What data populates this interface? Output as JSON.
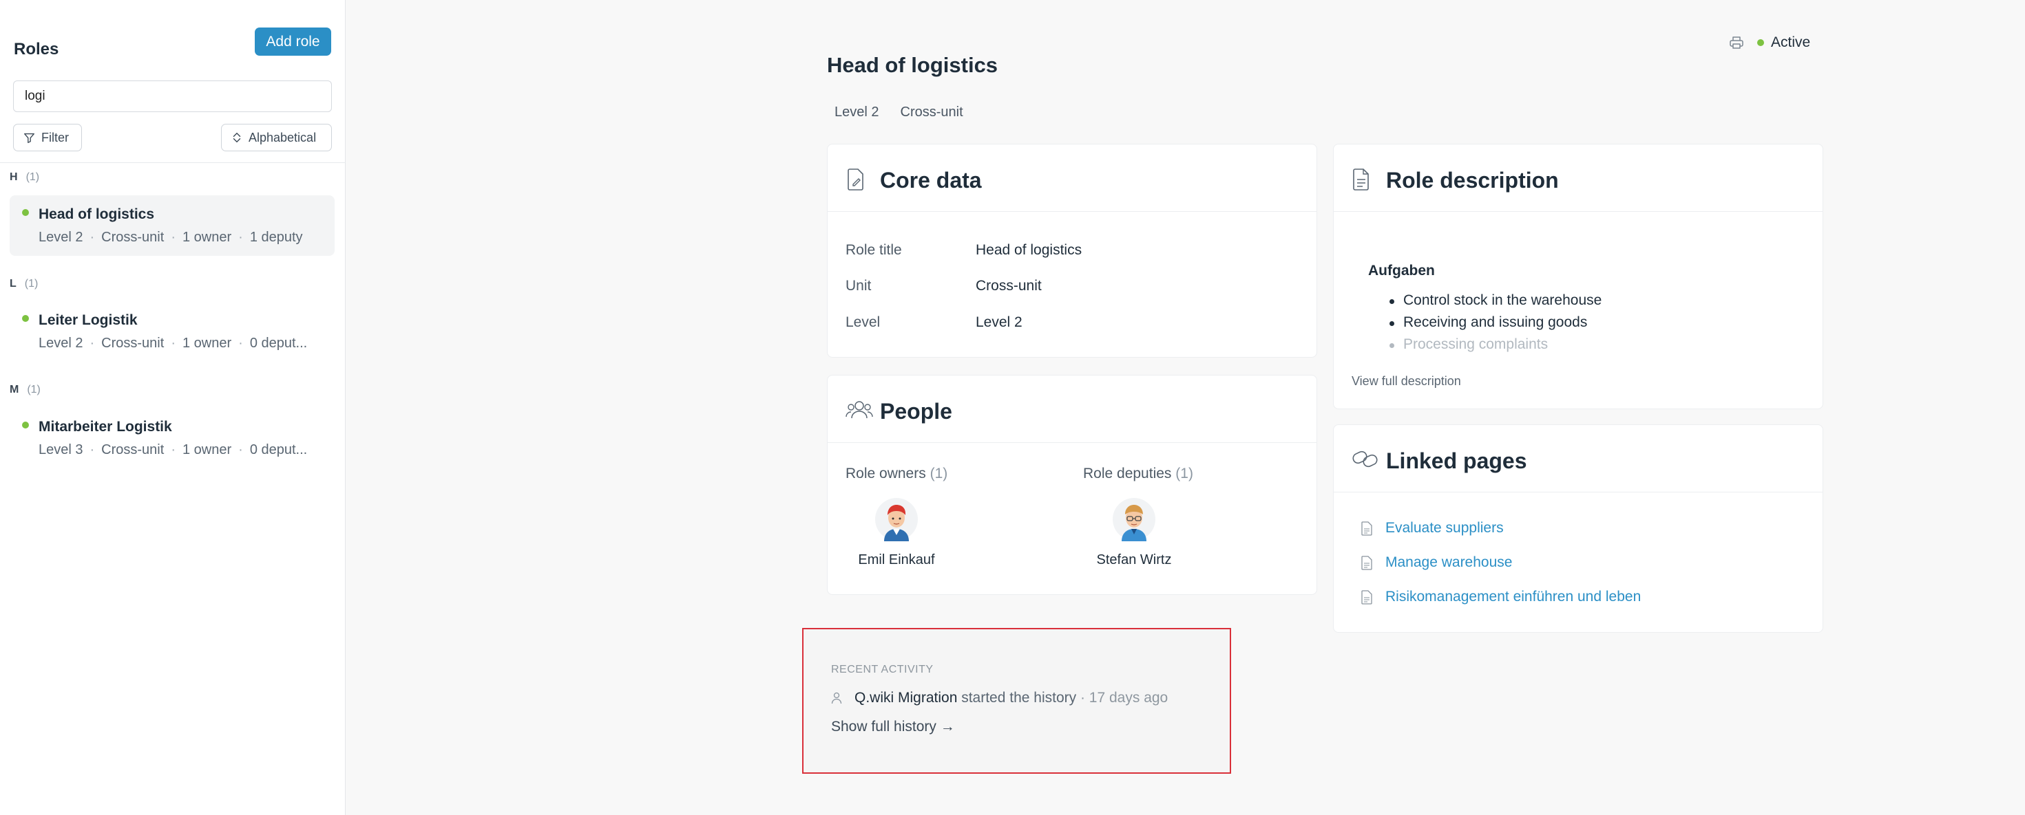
{
  "sidebar": {
    "title": "Roles",
    "add_label": "Add role",
    "search_value": "logi",
    "filter_label": "Filter",
    "sort_label": "Alphabetical",
    "groups": [
      {
        "letter": "H",
        "count": "(1)",
        "items": [
          {
            "name": "Head of logistics",
            "level": "Level 2",
            "unit": "Cross-unit",
            "owners": "1 owner",
            "deputies": "1 deputy"
          }
        ]
      },
      {
        "letter": "L",
        "count": "(1)",
        "items": [
          {
            "name": "Leiter Logistik",
            "level": "Level 2",
            "unit": "Cross-unit",
            "owners": "1 owner",
            "deputies": "0 deput..."
          }
        ]
      },
      {
        "letter": "M",
        "count": "(1)",
        "items": [
          {
            "name": "Mitarbeiter Logistik",
            "level": "Level 3",
            "unit": "Cross-unit",
            "owners": "1 owner",
            "deputies": "0 deput..."
          }
        ]
      }
    ]
  },
  "header": {
    "title": "Head of logistics",
    "tags": [
      "Level 2",
      "Cross-unit"
    ],
    "status": "Active"
  },
  "core_data": {
    "title": "Core data",
    "rows": [
      {
        "label": "Role title",
        "value": "Head of logistics"
      },
      {
        "label": "Unit",
        "value": "Cross-unit"
      },
      {
        "label": "Level",
        "value": "Level 2"
      }
    ]
  },
  "people": {
    "title": "People",
    "owners_label": "Role owners",
    "owners_count": "(1)",
    "owner_name": "Emil Einkauf",
    "deputies_label": "Role deputies",
    "deputies_count": "(1)",
    "deputy_name": "Stefan Wirtz"
  },
  "description": {
    "title": "Role description",
    "heading": "Aufgaben",
    "items": [
      "Control stock in the warehouse",
      "Receiving and issuing goods",
      "Processing complaints"
    ],
    "view_full": "View full description"
  },
  "linked_pages": {
    "title": "Linked pages",
    "items": [
      "Evaluate suppliers",
      "Manage warehouse",
      "Risikomanagement einführen und leben"
    ]
  },
  "activity": {
    "title": "RECENT ACTIVITY",
    "who": "Q.wiki Migration",
    "action": "started the history",
    "ago": "· 17 days ago",
    "show_more": "Show full history →"
  },
  "colors": {
    "accent": "#2b8fc6",
    "active": "#7dc241",
    "highlight_border": "#d9303a"
  }
}
